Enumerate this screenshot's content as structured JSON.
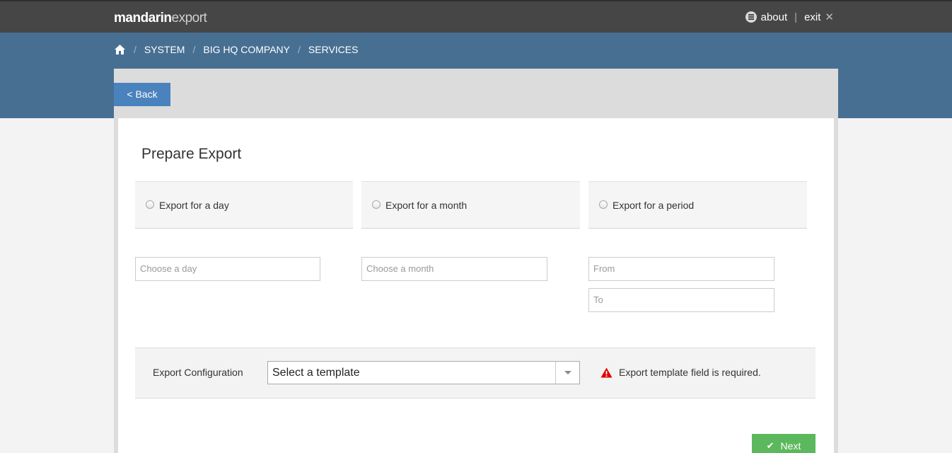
{
  "header": {
    "logo_bold": "mandarin",
    "logo_light": "export",
    "about_label": "about",
    "separator": "|",
    "exit_label": "exit"
  },
  "breadcrumb": {
    "items": [
      "SYSTEM",
      "BIG HQ COMPANY",
      "SERVICES"
    ],
    "separator": "/"
  },
  "back_button": "< Back",
  "page_title": "Prepare Export",
  "options": [
    {
      "label": "Export for a day",
      "selected": false
    },
    {
      "label": "Export for a month",
      "selected": false
    },
    {
      "label": "Export for a period",
      "selected": false
    }
  ],
  "fields": {
    "day_placeholder": "Choose a day",
    "month_placeholder": "Choose a month",
    "from_placeholder": "From",
    "to_placeholder": "To"
  },
  "config": {
    "label": "Export Configuration",
    "select_value": "Select a template",
    "error_message": "Export template field is required."
  },
  "next_button": "Next",
  "colors": {
    "topbar": "#464646",
    "bluebar": "#476f92",
    "back_button": "#4a82bd",
    "next_button": "#5cb85c",
    "error_icon": "#e00000"
  }
}
